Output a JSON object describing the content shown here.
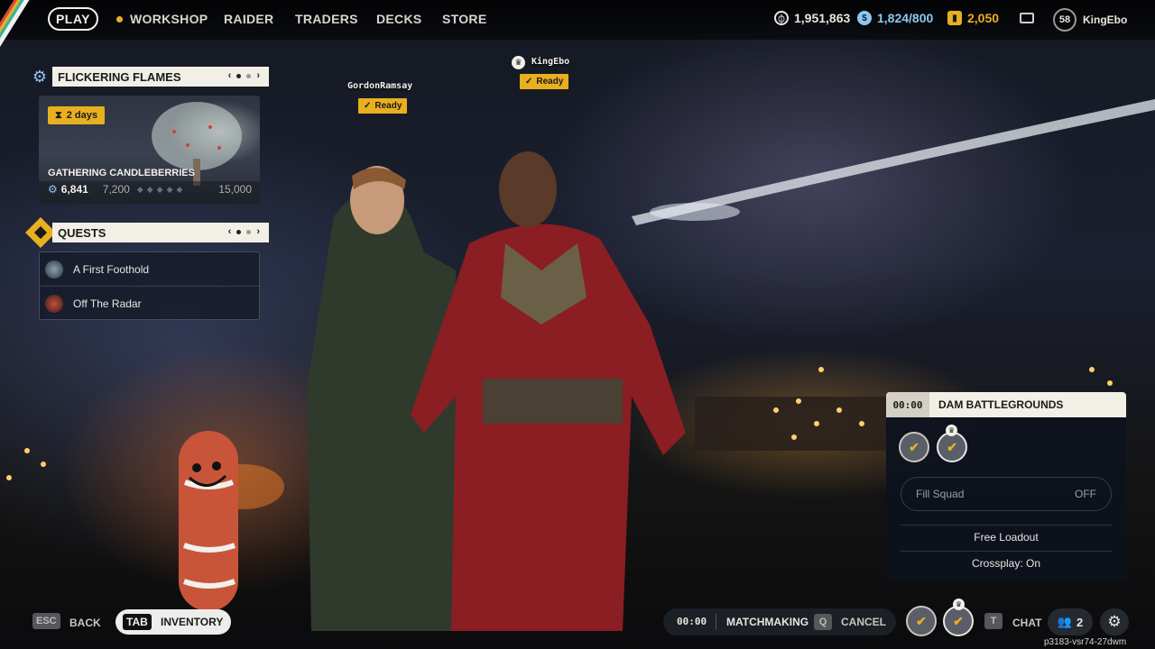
{
  "nav": {
    "play": "PLAY",
    "items": [
      "WORKSHOP",
      "RAIDER",
      "TRADERS",
      "DECKS",
      "STORE"
    ]
  },
  "currency": {
    "coins": "1,951,863",
    "raider_tokens": "1,824/800",
    "credits": "2,050"
  },
  "profile": {
    "level": "58",
    "username": "KingEbo"
  },
  "event": {
    "header": "FLICKERING FLAMES",
    "pager_prev": "‹",
    "pager_next": "›",
    "days": "2 days",
    "title": "GATHERING CANDLEBERRIES",
    "progress": "6,841",
    "milestone_mid": "7,200",
    "milestone_end": "15,000"
  },
  "quests": {
    "header": "QUESTS",
    "items": [
      {
        "label": "A First Foothold"
      },
      {
        "label": "Off The Radar"
      }
    ]
  },
  "players": [
    {
      "name": "GordonRamsay",
      "status": "Ready"
    },
    {
      "name": "KingEbo",
      "status": "Ready"
    }
  ],
  "squad": {
    "timer": "00:00",
    "map": "DAM BATTLEGROUNDS",
    "fill_label": "Fill Squad",
    "fill_value": "OFF",
    "loadout": "Free Loadout",
    "crossplay": "Crossplay: On"
  },
  "bottom": {
    "esc_key": "ESC",
    "back": "BACK",
    "tab_key": "TAB",
    "inventory": "INVENTORY",
    "mm_timer": "00:00",
    "matchmaking": "MATCHMAKING",
    "cancel_key": "Q",
    "cancel": "CANCEL",
    "chat_key": "T",
    "chat": "CHAT",
    "friends_count": "2",
    "build": "p3183-vsr74-27dwm"
  },
  "colors": {
    "accent": "#e8b020",
    "panel_light": "#f2efe6"
  }
}
